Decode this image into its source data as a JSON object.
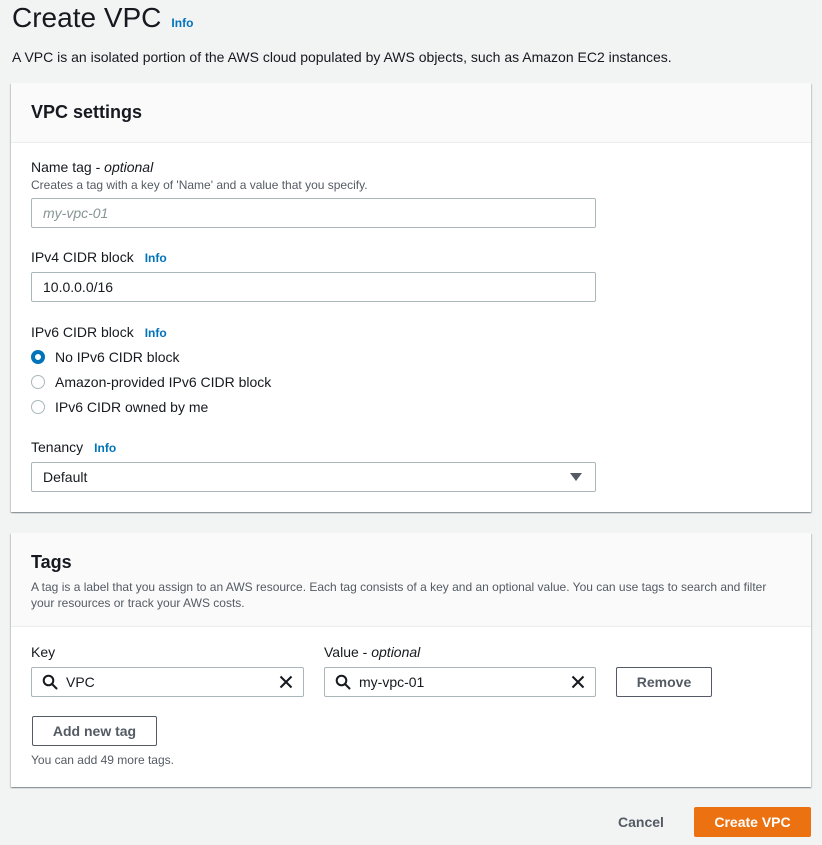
{
  "page": {
    "title": "Create VPC",
    "info_label": "Info",
    "description": "A VPC is an isolated portion of the AWS cloud populated by AWS objects, such as Amazon EC2 instances."
  },
  "vpc_settings": {
    "title": "VPC settings",
    "name_tag": {
      "label": "Name tag",
      "optional": "optional",
      "separator": " - ",
      "description": "Creates a tag with a key of 'Name' and a value that you specify.",
      "placeholder": "my-vpc-01",
      "value": ""
    },
    "ipv4": {
      "label": "IPv4 CIDR block",
      "info_label": "Info",
      "value": "10.0.0.0/16"
    },
    "ipv6": {
      "label": "IPv6 CIDR block",
      "info_label": "Info",
      "options": [
        {
          "label": "No IPv6 CIDR block",
          "checked": true
        },
        {
          "label": "Amazon-provided IPv6 CIDR block",
          "checked": false
        },
        {
          "label": "IPv6 CIDR owned by me",
          "checked": false
        }
      ]
    },
    "tenancy": {
      "label": "Tenancy",
      "info_label": "Info",
      "selected": "Default"
    }
  },
  "tags": {
    "title": "Tags",
    "description": "A tag is a label that you assign to an AWS resource. Each tag consists of a key and an optional value. You can use tags to search and filter your resources or track your AWS costs.",
    "key_label": "Key",
    "value_label": "Value",
    "value_optional": "optional",
    "separator": " - ",
    "key_value": "VPC",
    "value_value": "my-vpc-01",
    "remove_label": "Remove",
    "add_label": "Add new tag",
    "hint": "You can add 49 more tags."
  },
  "footer": {
    "cancel_label": "Cancel",
    "create_label": "Create VPC"
  },
  "colors": {
    "accent": "#0073bb",
    "primary_button": "#ec7211",
    "background": "#f2f3f3"
  },
  "icons": {
    "search": "search-icon",
    "clear": "close-icon",
    "caret": "caret-down-icon"
  }
}
